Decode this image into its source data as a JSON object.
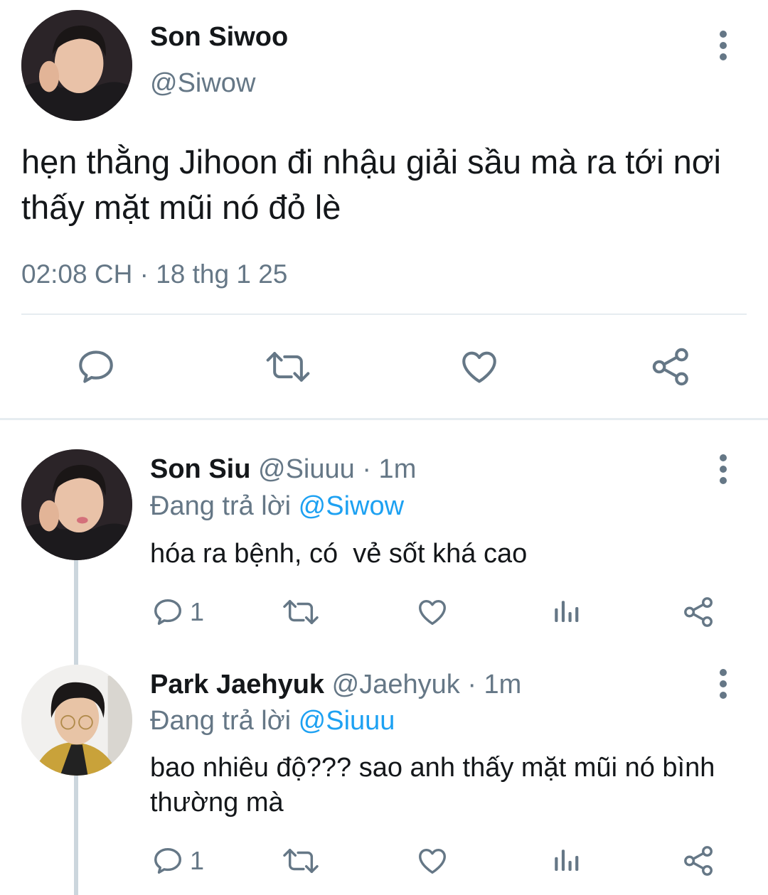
{
  "main_tweet": {
    "display_name": "Son Siwoo",
    "handle": "@Siwow",
    "text": "hẹn thằng Jihoon đi nhậu giải sầu mà ra tới nơi thấy mặt mũi nó đỏ lè",
    "timestamp": "02:08 CH · 18 thg 1 25",
    "actions": [
      "reply-icon",
      "retweet-icon",
      "like-icon",
      "share-icon"
    ]
  },
  "replies": [
    {
      "display_name": "Son Siu",
      "handle": "@Siuuu",
      "time": "· 1m",
      "replying_prefix": "Đang trả lời",
      "replying_to": "@Siwow",
      "text": "hóa ra bệnh, có  vẻ sốt khá cao",
      "reply_count": "1"
    },
    {
      "display_name": "Park Jaehyuk",
      "handle": "@Jaehyuk",
      "time": "· 1m",
      "replying_prefix": "Đang trả lời",
      "replying_to": "@Siuuu",
      "text": "bao nhiêu độ??? sao anh thấy mặt mũi nó bình thường mà",
      "reply_count": "1"
    }
  ],
  "colors": {
    "text": "#14171a",
    "secondary": "#657786",
    "accent": "#1da1f2",
    "divider": "#e6ecf0",
    "thread_line": "#ccd6dd"
  }
}
